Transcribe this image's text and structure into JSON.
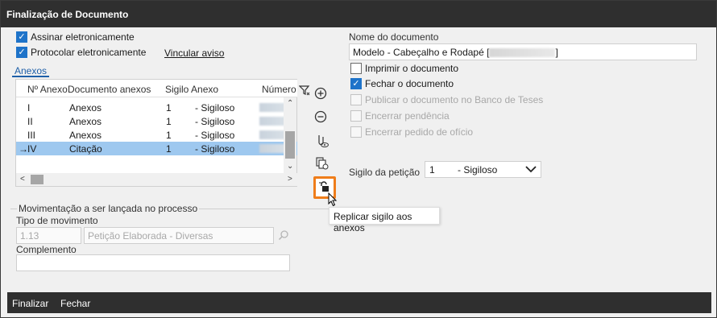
{
  "window": {
    "title": "Finalização de Documento"
  },
  "options": {
    "sign_label": "Assinar eletronicamente",
    "file_label": "Protocolar eletronicamente",
    "link_label": "Vincular aviso"
  },
  "tab": {
    "label": "Anexos"
  },
  "grid": {
    "columns": [
      "Nº Anexo",
      "Documento anexos",
      "Sigilo Anexo",
      "Número"
    ],
    "rows": [
      {
        "num": "I",
        "doc": "Anexos",
        "sig_code": "1",
        "sig_label": "- Sigiloso",
        "marker": ""
      },
      {
        "num": "II",
        "doc": "Anexos",
        "sig_code": "1",
        "sig_label": "- Sigiloso",
        "marker": ""
      },
      {
        "num": "III",
        "doc": "Anexos",
        "sig_code": "1",
        "sig_label": "- Sigiloso",
        "marker": ""
      },
      {
        "num": "IV",
        "doc": "Citação",
        "sig_code": "1",
        "sig_label": "- Sigiloso",
        "marker": "→"
      }
    ]
  },
  "movement": {
    "group_title": "Movimentação a ser lançada no processo",
    "type_label": "Tipo de movimento",
    "type_code": "1.13",
    "type_desc": "Petição Elaborada - Diversas",
    "complement_label": "Complemento",
    "complement_value": ""
  },
  "document": {
    "name_label": "Nome do documento",
    "name_value": "Modelo - Cabeçalho e Rodapé [",
    "name_suffix": "]",
    "print_label": "Imprimir o documento",
    "close_label": "Fechar o documento",
    "publish_label": "Publicar o documento no Banco de Teses",
    "end_pending_label": "Encerrar pendência",
    "end_request_label": "Encerrar pedido de ofício",
    "secrecy_label": "Sigilo da petição",
    "secrecy_code": "1",
    "secrecy_value": "- Sigiloso"
  },
  "tooltip": {
    "text": "Replicar sigilo aos anexos"
  },
  "footer": {
    "finish_label": "Finalizar",
    "close_label": "Fechar"
  },
  "colors": {
    "accent": "#1e73c9",
    "selection": "#9ec8ef",
    "highlight": "#ef7d1a",
    "titlebar": "#2f2f2f"
  }
}
